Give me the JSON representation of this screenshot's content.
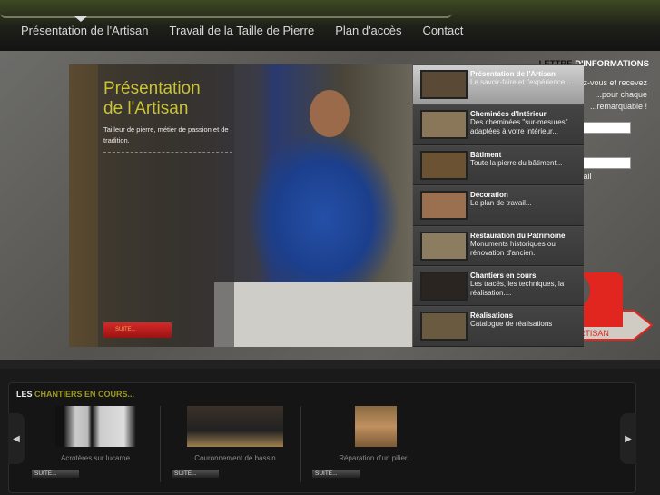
{
  "nav": {
    "items": [
      "Présentation de l'Artisan",
      "Travail de la Taille de Pierre",
      "Plan d'accès",
      "Contact"
    ],
    "active": 0
  },
  "newsletter": {
    "title_a": "LETTRE",
    "title_b": " D'INFORMATIONS",
    "lines": [
      "...z-vous et recevez",
      "...pour chaque",
      "...remarquable !"
    ],
    "fragment": "...ail"
  },
  "logo": {
    "text": "MAITRE ARTISAN",
    "color": "#e0261e"
  },
  "slide": {
    "title_line1": "Présentation",
    "title_line2": "de l'Artisan",
    "description": "Tailleur de pierre, métier de passion et de tradition.",
    "button": "SUITE...",
    "title_color": "#c9c430"
  },
  "menu": [
    {
      "title": "Présentation de l'Artisan",
      "desc": "Le savoir-faire et l'expérience...",
      "active": true,
      "thumb": "#5a4a35"
    },
    {
      "title": "Cheminées d'Intérieur",
      "desc": "Des cheminées \"sur-mesures\" adaptées à votre intérieur...",
      "thumb": "#8a7658"
    },
    {
      "title": "Bâtiment",
      "desc": "Toute la pierre du bâtiment...",
      "thumb": "#6a5232"
    },
    {
      "title": "Décoration",
      "desc": "Le plan de travail...",
      "thumb": "#9a7050"
    },
    {
      "title": "Restauration du Patrimoine",
      "desc": "Monuments historiques ou rénovation d'ancien.",
      "thumb": "#8c7c60"
    },
    {
      "title": "Chantiers en cours",
      "desc": "Les tracés, les techniques, la réalisation....",
      "thumb": "#2a2520"
    },
    {
      "title": "Réalisations",
      "desc": "Catalogue de réalisations",
      "thumb": "#6a5a40"
    }
  ],
  "chantiers": {
    "title_a": "LES ",
    "title_b": "CHANTIERS EN COURS...",
    "items": [
      {
        "caption": "Acrotères sur lucarne",
        "button": "SUITE..."
      },
      {
        "caption": "Couronnement de bassin",
        "button": "SUITE..."
      },
      {
        "caption": "Réparation d'un pilier...",
        "button": "SUITE..."
      }
    ]
  }
}
